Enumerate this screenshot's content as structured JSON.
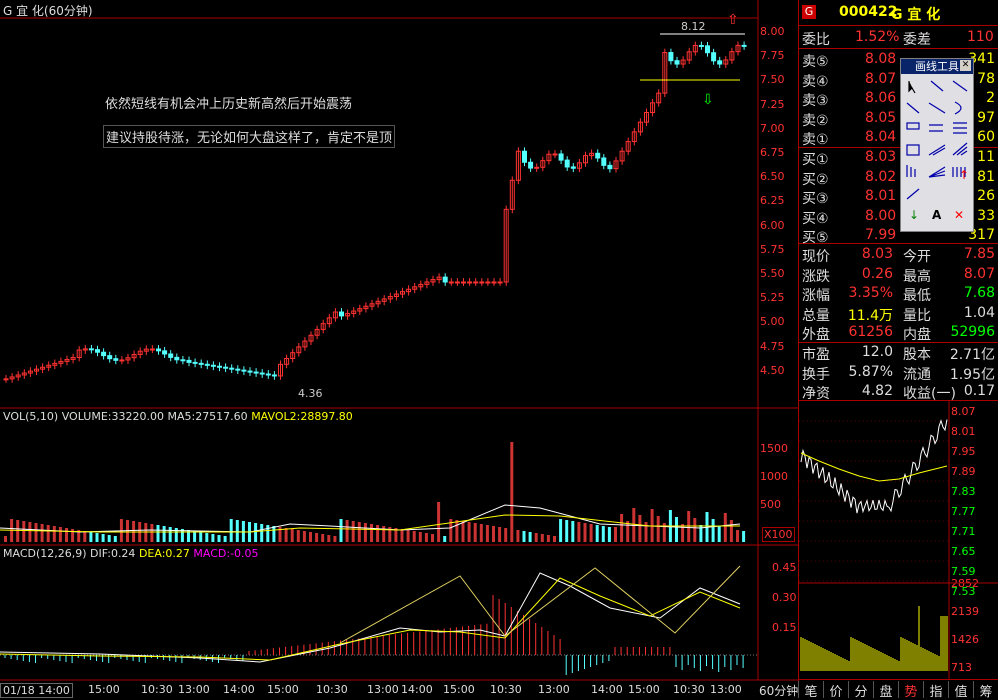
{
  "title": "G 宜  化(60分钟)",
  "annotations": {
    "note1": "依然短线有机会冲上历史新高然后开始震荡",
    "note2": "建议持股待涨，无论如何大盘这样了，肯定不是顶",
    "high_label": "8.12",
    "low_label": "4.36"
  },
  "price_axis": [
    "8.00",
    "7.75",
    "7.50",
    "7.25",
    "7.00",
    "6.75",
    "6.50",
    "6.25",
    "6.00",
    "5.75",
    "5.50",
    "5.25",
    "5.00",
    "4.75",
    "4.50"
  ],
  "vol_header": {
    "name": "VOL(5,10)",
    "volume": "VOLUME:33220.00",
    "ma5": "MA5:27517.60",
    "mavol2": "MAVOL2:28897.80"
  },
  "vol_axis": [
    "1500",
    "1000",
    "500"
  ],
  "vol_unit": "X100",
  "macd_header": {
    "name": "MACD(12,26,9)",
    "dif": "DIF:0.24",
    "dea": "DEA:0.27",
    "macd": "MACD:-0.05"
  },
  "macd_axis": [
    "0.45",
    "0.30",
    "0.15"
  ],
  "time_axis": [
    "01/18 14:00",
    "15:00",
    "10:30",
    "13:00",
    "14:00",
    "15:00",
    "10:30",
    "13:00",
    "14:00",
    "15:00",
    "10:30",
    "13:00",
    "14:00",
    "15:00",
    "10:30",
    "13:00"
  ],
  "time_mode": "60分钟",
  "stock": {
    "code": "000422",
    "name": "G 宜  化",
    "badge": "G"
  },
  "order_ratio": {
    "label": "委比",
    "value": "1.52%",
    "label2": "委差",
    "value2": "110"
  },
  "sell": [
    {
      "label": "卖⑤",
      "price": "8.08",
      "vol": "341"
    },
    {
      "label": "卖④",
      "price": "8.07",
      "vol": "78"
    },
    {
      "label": "卖③",
      "price": "8.06",
      "vol": "2"
    },
    {
      "label": "卖②",
      "price": "8.05",
      "vol": "97"
    },
    {
      "label": "卖①",
      "price": "8.04",
      "vol": "60"
    }
  ],
  "buy": [
    {
      "label": "买①",
      "price": "8.03",
      "vol": "11"
    },
    {
      "label": "买②",
      "price": "8.02",
      "vol": "81"
    },
    {
      "label": "买③",
      "price": "8.01",
      "vol": "26"
    },
    {
      "label": "买④",
      "price": "8.00",
      "vol": "33"
    },
    {
      "label": "买⑤",
      "price": "7.99",
      "vol": "317"
    }
  ],
  "quote": [
    {
      "l1": "现价",
      "v1": "8.03",
      "l2": "今开",
      "v2": "7.85"
    },
    {
      "l1": "涨跌",
      "v1": "0.26",
      "l2": "最高",
      "v2": "8.07"
    },
    {
      "l1": "涨幅",
      "v1": "3.35%",
      "l2": "最低",
      "v2": "7.68"
    },
    {
      "l1": "总量",
      "v1": "11.4万",
      "l2": "量比",
      "v2": "1.04"
    },
    {
      "l1": "外盘",
      "v1": "61256",
      "l2": "内盘",
      "v2": "52996"
    }
  ],
  "fundamentals": [
    {
      "l1": "市盈",
      "v1": "12.0",
      "l2": "股本",
      "v2": "2.71亿"
    },
    {
      "l1": "换手",
      "v1": "5.87%",
      "l2": "流通",
      "v2": "1.95亿"
    },
    {
      "l1": "净资",
      "v1": "4.82",
      "l2": "收益(一)",
      "v2": "0.17"
    }
  ],
  "mini_axis": [
    "8.07",
    "8.01",
    "7.95",
    "7.89",
    "7.83",
    "7.77",
    "7.71",
    "7.65",
    "7.59",
    "7.53"
  ],
  "mini_vol_axis": [
    "2852",
    "2139",
    "1426",
    "713"
  ],
  "tabs": [
    "笔",
    "价",
    "分",
    "盘",
    "势",
    "指",
    "值",
    "筹"
  ],
  "toolbox_title": "画线工具",
  "toolbox_text_tool": "A",
  "colors": {
    "up": "#ff3232",
    "down": "#54ffff",
    "frame": "#aa0000",
    "volume_green": "#00ff00",
    "yellow": "#ffff00"
  }
}
